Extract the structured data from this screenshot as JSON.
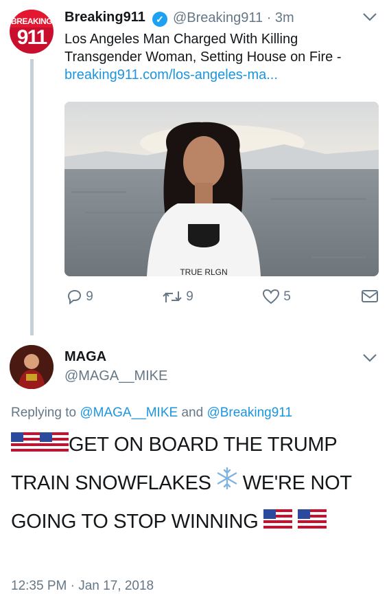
{
  "tweet1": {
    "avatar_text_top": "BREAKING",
    "avatar_text_num": "911",
    "name": "Breaking911",
    "handle": "@Breaking911",
    "time": "· 3m",
    "text": "Los Angeles Man Charged With Killing Transgender Woman, Setting House on Fire -",
    "link": "breaking911.com/los-angeles-ma...",
    "shirt_text": "TRUE RLGN",
    "replies": "9",
    "retweets": "9",
    "likes": "5"
  },
  "tweet2": {
    "name": "MAGA",
    "handle": "@MAGA__MIKE",
    "replying_prefix": "Replying to",
    "replying_mention1": "@MAGA__MIKE",
    "replying_and": "and",
    "replying_mention2": "@Breaking911",
    "text_part1": "GET ON BOARD THE TRUMP TRAIN SNOWFLAKES",
    "text_part2": "WE'RE NOT GOING TO STOP WINNING",
    "timestamp": "12:35 PM · Jan 17, 2018"
  },
  "icons": {
    "verified": "verified-badge-icon",
    "chevron": "chevron-down-icon",
    "reply": "reply-icon",
    "retweet": "retweet-icon",
    "like": "heart-icon",
    "dm": "envelope-icon",
    "flag": "us-flag-icon",
    "snowflake": "snowflake-icon"
  },
  "colors": {
    "link": "#1b95e0",
    "secondary_text": "#657786",
    "verified": "#1da1f2",
    "brand_red": "#e3172f"
  }
}
